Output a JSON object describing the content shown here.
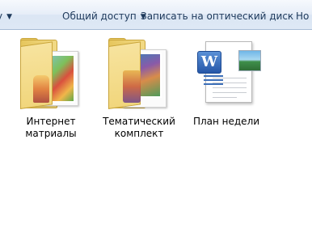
{
  "toolbar": {
    "left_cut_label": "у",
    "share_label": "Общий доступ",
    "burn_label": "Записать на оптический диск",
    "new_cut_label": "Но"
  },
  "items": [
    {
      "label_line1": "Интернет",
      "label_line2": "матриалы",
      "icon": "folder-icon"
    },
    {
      "label_line1": "Тематический",
      "label_line2": "комплект",
      "icon": "folder-icon"
    },
    {
      "label_line1": "План недели",
      "icon": "word-document-icon"
    }
  ],
  "colors": {
    "toolbar_text": "#1e395b",
    "folder": "#f1d67c",
    "word_blue": "#2b579a"
  }
}
